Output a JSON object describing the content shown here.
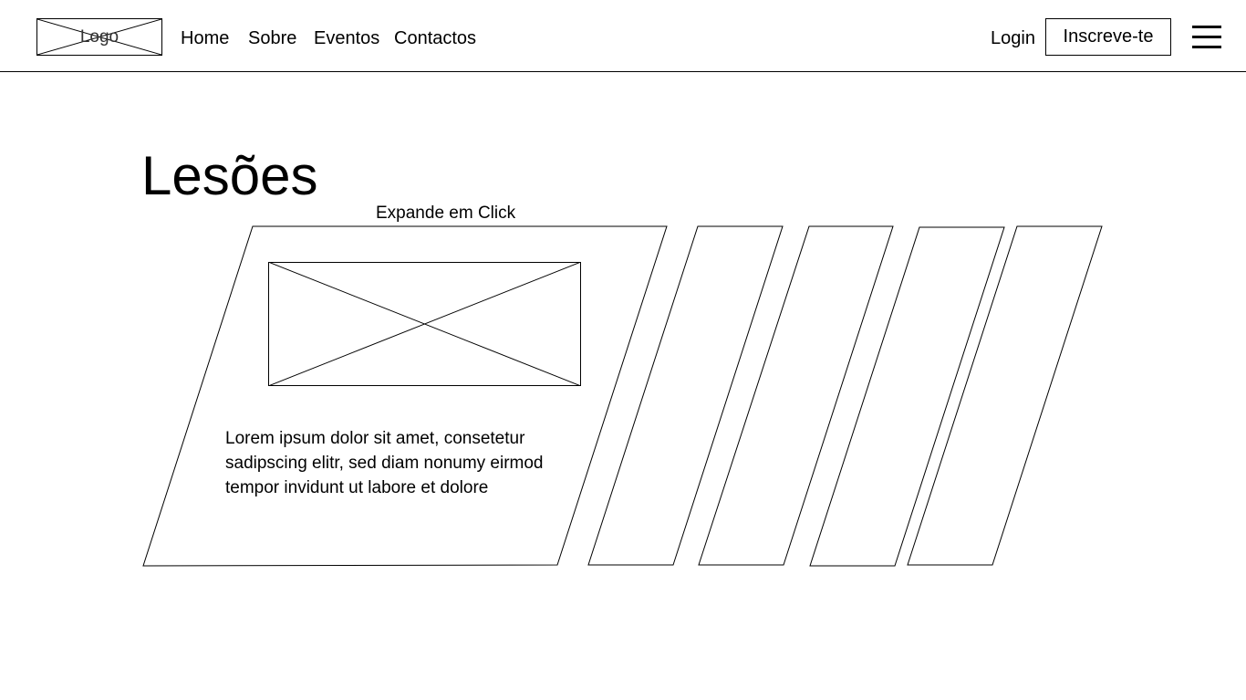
{
  "nav": {
    "logo_label": "Logo",
    "links": [
      "Home",
      "Sobre",
      "Eventos",
      "Contactos"
    ],
    "login_label": "Login",
    "signup_label": "Inscreve-te",
    "menu_icon": "hamburger-menu-icon"
  },
  "page": {
    "title": "Lesões",
    "expand_hint": "Expande em Click"
  },
  "card": {
    "text": "Lorem ipsum dolor sit amet, consetetur sadipscing elitr, sed diam nonumy eirmod tempor invidunt ut labore et dolore",
    "image_icon": "image-placeholder-icon"
  }
}
